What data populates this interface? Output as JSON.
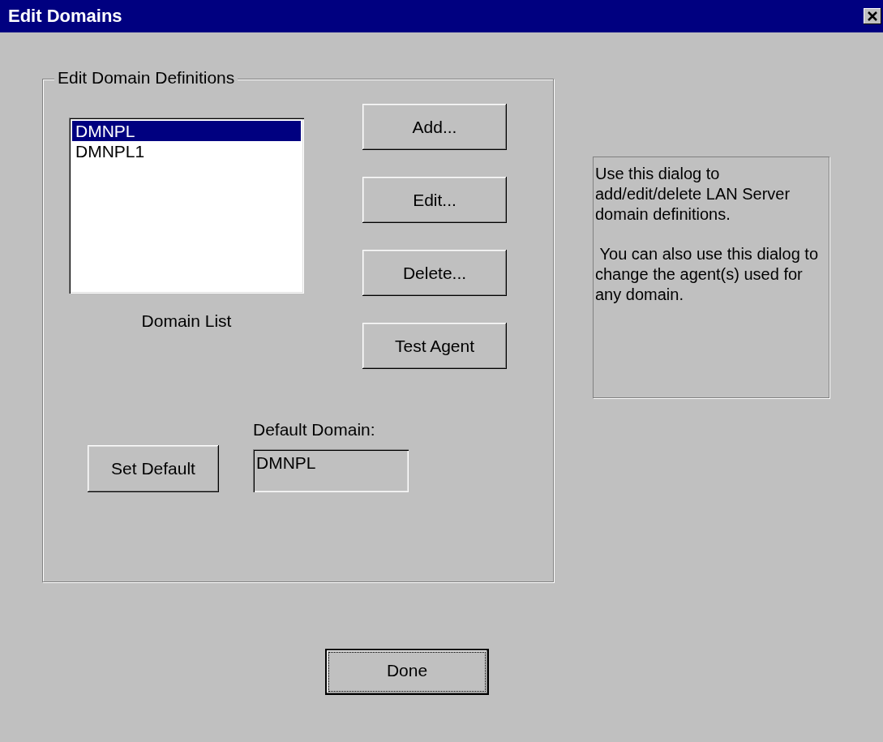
{
  "window": {
    "title": "Edit Domains"
  },
  "group": {
    "title": "Edit Domain Definitions",
    "domain_list": {
      "items": [
        {
          "label": "DMNPL",
          "selected": true
        },
        {
          "label": "DMNPL1",
          "selected": false
        }
      ],
      "caption": "Domain List"
    },
    "buttons": [
      "Add...",
      "Edit...",
      "Delete...",
      "Test Agent"
    ],
    "set_default_button": "Set Default",
    "default_domain": {
      "label": "Default Domain:",
      "value": "DMNPL"
    }
  },
  "help_text": [
    "Use this dialog to add/edit/delete LAN Server domain definitions.",
    " You can also use this dialog to change the agent(s) used for any domain."
  ],
  "done_button": {
    "label": "Done",
    "focused": true
  }
}
